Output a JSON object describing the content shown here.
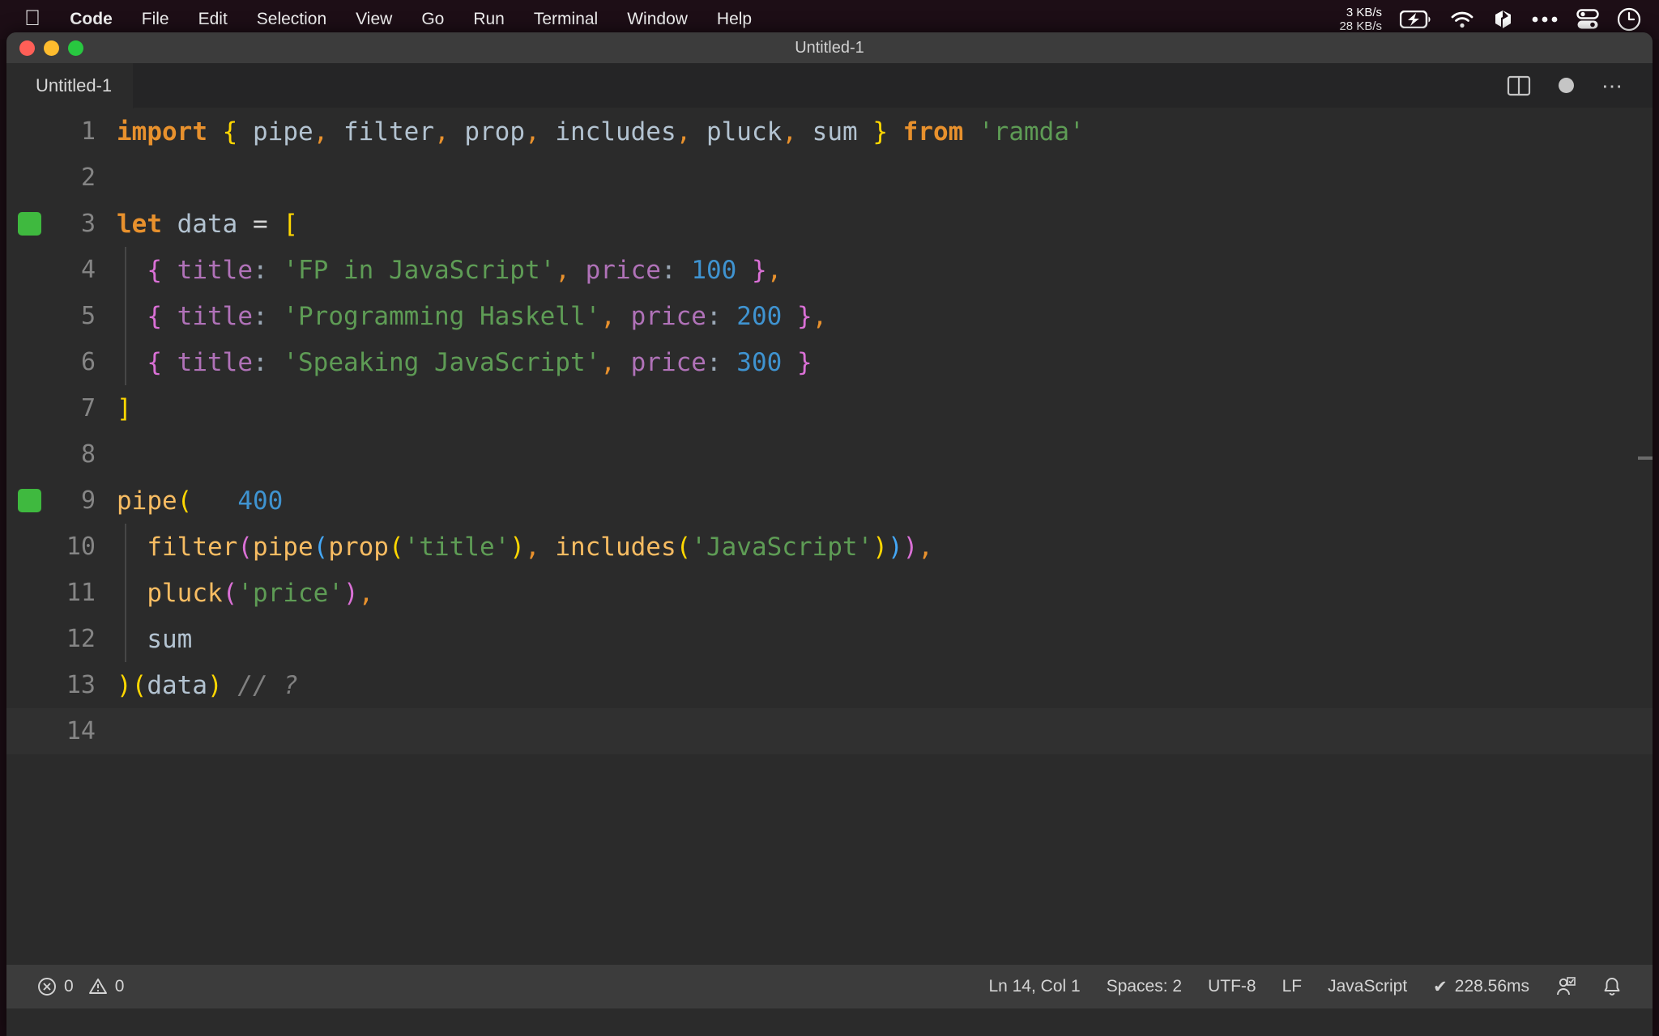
{
  "menubar": {
    "apple_icon": "apple-logo",
    "items": [
      {
        "label": "Code",
        "bold": true
      },
      {
        "label": "File",
        "bold": false
      },
      {
        "label": "Edit",
        "bold": false
      },
      {
        "label": "Selection",
        "bold": false
      },
      {
        "label": "View",
        "bold": false
      },
      {
        "label": "Go",
        "bold": false
      },
      {
        "label": "Run",
        "bold": false
      },
      {
        "label": "Terminal",
        "bold": false
      },
      {
        "label": "Window",
        "bold": false
      },
      {
        "label": "Help",
        "bold": false
      }
    ],
    "status": {
      "net_down": "3 KB/s",
      "net_up": "28 KB/s",
      "icons": [
        "battery-charging-icon",
        "wifi-icon",
        "dropbox-icon",
        "ellipsis-icon",
        "control-center-icon",
        "clock-icon"
      ]
    }
  },
  "window": {
    "title": "Untitled-1",
    "traffic_lights": [
      "close-button",
      "minimize-button",
      "maximize-button"
    ]
  },
  "tabbar": {
    "tab_label": "Untitled-1",
    "actions": [
      "split-editor-icon",
      "unsaved-indicator",
      "more-actions-icon"
    ]
  },
  "editor": {
    "language": "JavaScript",
    "lines": [
      {
        "num": "1",
        "breakpoint": false,
        "indent": false,
        "current": false
      },
      {
        "num": "2",
        "breakpoint": false,
        "indent": false,
        "current": false
      },
      {
        "num": "3",
        "breakpoint": true,
        "indent": false,
        "current": false
      },
      {
        "num": "4",
        "breakpoint": false,
        "indent": true,
        "current": false
      },
      {
        "num": "5",
        "breakpoint": false,
        "indent": true,
        "current": false
      },
      {
        "num": "6",
        "breakpoint": false,
        "indent": true,
        "current": false
      },
      {
        "num": "7",
        "breakpoint": false,
        "indent": false,
        "current": false
      },
      {
        "num": "8",
        "breakpoint": false,
        "indent": false,
        "current": false
      },
      {
        "num": "9",
        "breakpoint": true,
        "indent": false,
        "current": false
      },
      {
        "num": "10",
        "breakpoint": false,
        "indent": true,
        "current": false
      },
      {
        "num": "11",
        "breakpoint": false,
        "indent": true,
        "current": false
      },
      {
        "num": "12",
        "breakpoint": false,
        "indent": true,
        "current": false
      },
      {
        "num": "13",
        "breakpoint": false,
        "indent": false,
        "current": false
      },
      {
        "num": "14",
        "breakpoint": false,
        "indent": false,
        "current": true
      }
    ],
    "source_text": [
      "import { pipe, filter, prop, includes, pluck, sum } from 'ramda'",
      "",
      "let data = [",
      "  { title: 'FP in JavaScript', price: 100 },",
      "  { title: 'Programming Haskell', price: 200 },",
      "  { title: 'Speaking JavaScript', price: 300 }",
      "]",
      "",
      "pipe(",
      "  filter(pipe(prop('title'), includes('JavaScript'))),",
      "  pluck('price'),",
      "  sum",
      ")(data) // ?",
      ""
    ],
    "inline_value": "400",
    "tokens": {
      "l1": {
        "kw": "import",
        "b1": "{",
        "id1": "pipe",
        "c1": ",",
        "id2": "filter",
        "c2": ",",
        "id3": "prop",
        "c3": ",",
        "id4": "includes",
        "c4": ",",
        "id5": "pluck",
        "c5": ",",
        "id6": "sum",
        "b2": "}",
        "kw2": "from",
        "str": "'ramda'"
      },
      "l3": {
        "kw": "let",
        "id": "data",
        "op": "=",
        "br": "["
      },
      "l4": {
        "open": "{",
        "key": "title",
        "colon": ":",
        "str": "'FP in JavaScript'",
        "comma": ",",
        "key2": "price",
        "colon2": ":",
        "num": "100",
        "close": "}",
        "trail": ","
      },
      "l5": {
        "open": "{",
        "key": "title",
        "colon": ":",
        "str": "'Programming Haskell'",
        "comma": ",",
        "key2": "price",
        "colon2": ":",
        "num": "200",
        "close": "}",
        "trail": ","
      },
      "l6": {
        "open": "{",
        "key": "title",
        "colon": ":",
        "str": "'Speaking JavaScript'",
        "comma": ",",
        "key2": "price",
        "colon2": ":",
        "num": "300",
        "close": "}"
      },
      "l7": {
        "br": "]"
      },
      "l9": {
        "fn": "pipe",
        "paren": "(",
        "inline": "400"
      },
      "l10": {
        "fn1": "filter",
        "p1": "(",
        "fn2": "pipe",
        "p2": "(",
        "fn3": "prop",
        "p3": "(",
        "s1": "'title'",
        "cp3": ")",
        "comma": ",",
        "fn4": "includes",
        "p4": "(",
        "s2": "'JavaScript'",
        "cp4": ")",
        "cp2": ")",
        "cp1": ")",
        "trail": ","
      },
      "l11": {
        "fn": "pluck",
        "p": "(",
        "s": "'price'",
        "cp": ")",
        "trail": ","
      },
      "l12": {
        "id": "sum"
      },
      "l13": {
        "cp": ")",
        "op": "(",
        "id": "data",
        "cpp": ")",
        "comment": "// ?"
      }
    }
  },
  "statusbar": {
    "errors": "0",
    "warnings": "0",
    "position": "Ln 14, Col 1",
    "spaces": "Spaces: 2",
    "encoding": "UTF-8",
    "eol": "LF",
    "language": "JavaScript",
    "quokka": "228.56ms",
    "quokka_check": "✔",
    "icons": [
      "error-icon",
      "warning-icon",
      "remote-account-icon",
      "notifications-bell-icon"
    ]
  }
}
